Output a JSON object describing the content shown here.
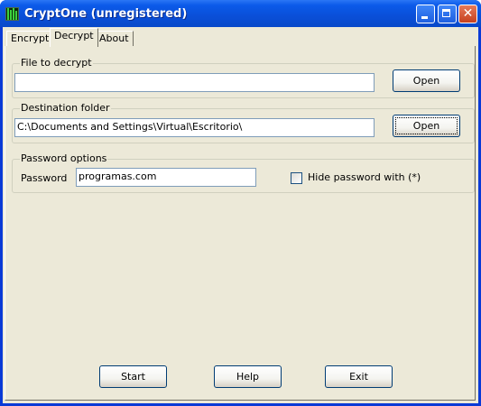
{
  "window": {
    "title": "CryptOne (unregistered)"
  },
  "tabs": [
    {
      "label": "Encrypt",
      "active": false
    },
    {
      "label": "Decrypt",
      "active": true
    },
    {
      "label": "About",
      "active": false
    }
  ],
  "file_to_decrypt": {
    "group_label": "File to decrypt",
    "value": "",
    "open_label": "Open"
  },
  "destination_folder": {
    "group_label": "Destination folder",
    "value": "C:\\Documents and Settings\\Virtual\\Escritorio\\",
    "open_label": "Open"
  },
  "password_options": {
    "group_label": "Password options",
    "password_label": "Password",
    "password_value": "programas.com",
    "hide_label": "Hide password with (*)",
    "hide_checked": false
  },
  "footer": {
    "start_label": "Start",
    "help_label": "Help",
    "exit_label": "Exit"
  },
  "colors": {
    "titlebar": "#0a4fd8",
    "face": "#ece9d8",
    "accent_close": "#c6401f"
  }
}
